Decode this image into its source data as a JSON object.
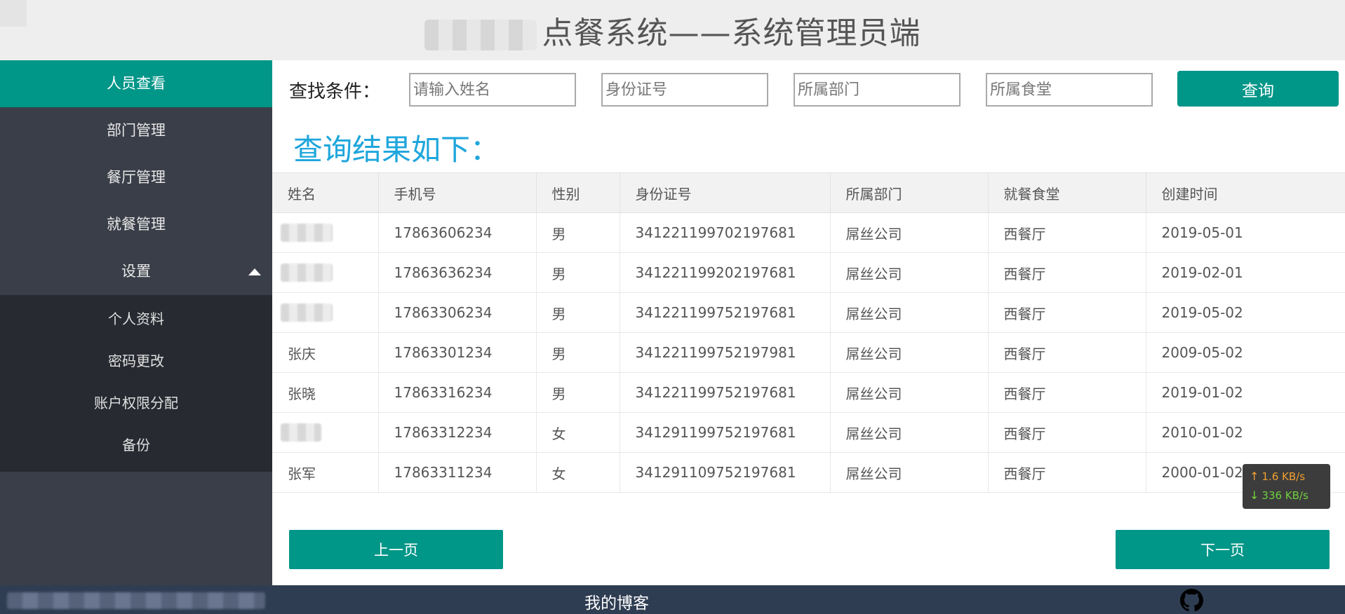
{
  "header": {
    "title": "点餐系统——系统管理员端"
  },
  "sidebar": {
    "items": [
      {
        "label": "人员查看",
        "active": true
      },
      {
        "label": "部门管理"
      },
      {
        "label": "餐厅管理"
      },
      {
        "label": "就餐管理"
      },
      {
        "label": "设置",
        "expanded": true
      }
    ],
    "settings_sub": [
      {
        "label": "个人资料"
      },
      {
        "label": "密码更改"
      },
      {
        "label": "账户权限分配"
      },
      {
        "label": "备份"
      }
    ]
  },
  "search": {
    "label": "查找条件：",
    "name_placeholder": "请输入姓名",
    "id_placeholder": "身份证号",
    "dept_placeholder": "所属部门",
    "canteen_placeholder": "所属食堂",
    "button_label": "查询"
  },
  "results": {
    "title": "查询结果如下：",
    "columns": [
      "姓名",
      "手机号",
      "性别",
      "身份证号",
      "所属部门",
      "就餐食堂",
      "创建时间"
    ],
    "rows": [
      {
        "name": "",
        "phone": "17863606234",
        "gender": "男",
        "id": "341221199702197681",
        "dept": "屌丝公司",
        "canteen": "西餐厅",
        "created": "2019-05-01"
      },
      {
        "name": "",
        "phone": "17863636234",
        "gender": "男",
        "id": "341221199202197681",
        "dept": "屌丝公司",
        "canteen": "西餐厅",
        "created": "2019-02-01"
      },
      {
        "name": "",
        "phone": "17863306234",
        "gender": "男",
        "id": "341221199752197681",
        "dept": "屌丝公司",
        "canteen": "西餐厅",
        "created": "2019-05-02"
      },
      {
        "name": "张庆",
        "phone": "17863301234",
        "gender": "男",
        "id": "341221199752197981",
        "dept": "屌丝公司",
        "canteen": "西餐厅",
        "created": "2009-05-02"
      },
      {
        "name": "张晓",
        "phone": "17863316234",
        "gender": "男",
        "id": "341221199752197681",
        "dept": "屌丝公司",
        "canteen": "西餐厅",
        "created": "2019-01-02"
      },
      {
        "name": "",
        "phone": "17863312234",
        "gender": "女",
        "id": "341291199752197681",
        "dept": "屌丝公司",
        "canteen": "西餐厅",
        "created": "2010-01-02"
      },
      {
        "name": "张军",
        "phone": "17863311234",
        "gender": "女",
        "id": "341291109752197681",
        "dept": "屌丝公司",
        "canteen": "西餐厅",
        "created": "2000-01-02"
      }
    ]
  },
  "pager": {
    "prev_label": "上一页",
    "next_label": "下一页"
  },
  "netspeed": {
    "up": "1.6 KB/s",
    "down": "336 KB/s"
  },
  "footer": {
    "blog_label": "我的博客",
    "github_icon": "github-icon"
  },
  "colors": {
    "accent": "#009688",
    "sidebar_bg": "#3a3e48",
    "submenu_bg": "#272a31",
    "results_title": "#1ea6dc",
    "footer_bg": "#2f3d52"
  }
}
